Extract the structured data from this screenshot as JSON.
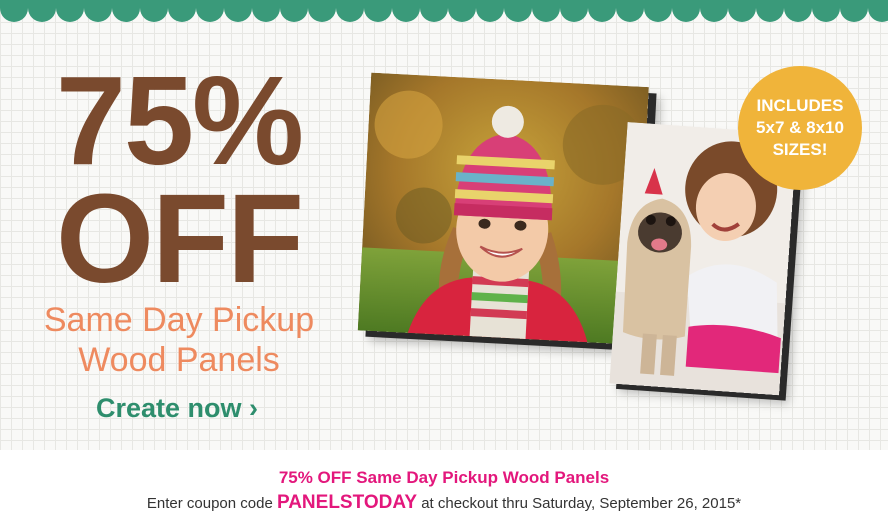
{
  "promo": {
    "headline_percent": "75%",
    "headline_off": "OFF",
    "subhead_line1": "Same Day Pickup",
    "subhead_line2": "Wood Panels",
    "cta_label": "Create now ›"
  },
  "badge": {
    "line1": "INCLUDES",
    "line2": "5x7 & 8x10",
    "line3": "SIZES!"
  },
  "images": {
    "panel_large": "girl-in-striped-knit-hat-photo",
    "panel_small": "girl-with-pug-photo"
  },
  "footer": {
    "title": "75% OFF Same Day Pickup Wood Panels",
    "text_before_code": "Enter coupon code ",
    "coupon_code": "PANELSTODAY",
    "text_after_code": " at checkout thru Saturday, September 26, 2015*"
  },
  "colors": {
    "brand_green": "#3a9a7a",
    "headline_brown": "#7a4a2e",
    "subhead_orange": "#ee8a5f",
    "badge_gold": "#f0b43a",
    "coupon_pink": "#e3177c"
  }
}
